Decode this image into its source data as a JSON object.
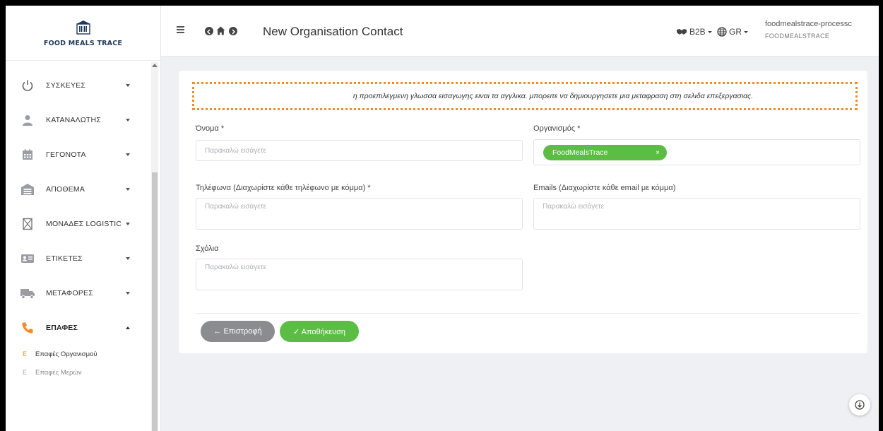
{
  "brand": {
    "name": "FOOD MEALS TRACE",
    "logo_icon": "barcode-building-icon"
  },
  "sidebar": {
    "items": [
      {
        "label": "ΣΥΣΚΕΥΕΣ",
        "icon": "power-icon"
      },
      {
        "label": "ΚΑΤΑΝΑΛΩΤΗΣ",
        "icon": "user-icon"
      },
      {
        "label": "ΓΕΓΟΝΟΤΑ",
        "icon": "calendar-icon"
      },
      {
        "label": "ΑΠΟΘΕΜΑ",
        "icon": "warehouse-icon"
      },
      {
        "label": "ΜΟΝΑΔΕΣ LOGISTIC",
        "icon": "box-icon"
      },
      {
        "label": "ΕΤΙΚΕΤΕΣ",
        "icon": "id-card-icon"
      },
      {
        "label": "ΜΕΤΑΦΟΡΕΣ",
        "icon": "truck-icon"
      },
      {
        "label": "ΕΠΑΦΕΣ",
        "icon": "phone-icon"
      }
    ],
    "subitems": [
      {
        "letter": "E",
        "label": "Επαφές Οργανισμού"
      },
      {
        "letter": "E",
        "label": "Επαφές Μερών"
      }
    ]
  },
  "topbar": {
    "title": "New Organisation Contact",
    "b2b_label": "B2B",
    "lang_label": "GR",
    "user_name": "foodmealstrace-processc",
    "user_org": "FOODMEALSTRACE"
  },
  "form": {
    "notice": "η προεπιλεγμενη γλωσσα εισαγωγης ειναι τα αγγλικα. μπορειτε να δημιουργησετε μια μεταφραση στη σελιδα επεξεργασιας.",
    "name_label": "Όνομα *",
    "name_placeholder": "Παρακαλώ εισάγετε",
    "organisation_label": "Οργανισμός *",
    "organisation_value": "FoodMealsTrace",
    "organisation_remove": "×",
    "phones_label": "Τηλέφωνα (Διαχωρίστε κάθε τηλέφωνο με κόμμα) *",
    "phones_placeholder": "Παρακαλώ εισάγετε",
    "emails_label": "Emails (Διαχωρίστε κάθε email με κόμμα)",
    "emails_placeholder": "Παρακαλώ εισάγετε",
    "comments_label": "Σχόλια",
    "comments_placeholder": "Παρακαλώ εισάγετε",
    "back_button": "← Επιστροφή",
    "save_button": "✓ Αποθήκευση"
  },
  "colors": {
    "accent_green": "#5cbd45",
    "accent_orange": "#f28c28",
    "neutral_button": "#8a8c90"
  }
}
